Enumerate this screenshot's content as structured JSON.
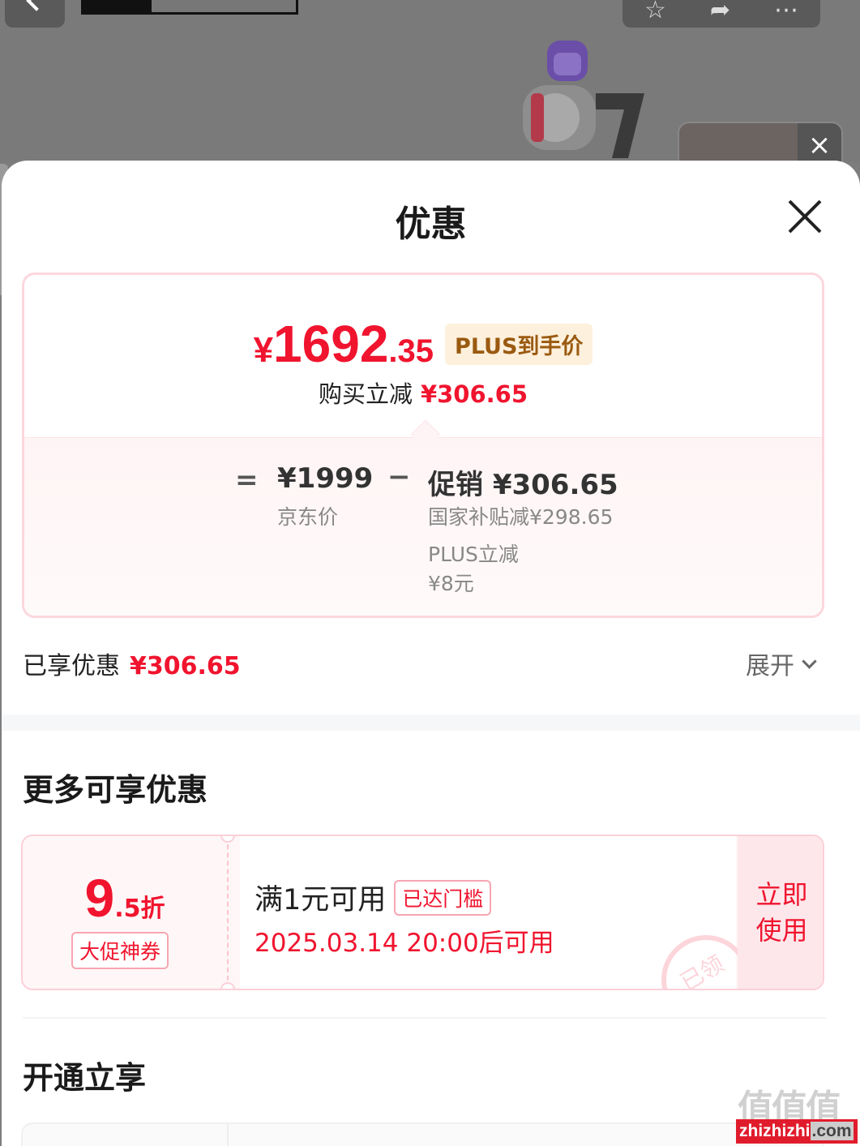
{
  "sheet": {
    "title": "优惠"
  },
  "summary": {
    "price_symbol": "¥",
    "price_int": "1692",
    "price_dec": ".35",
    "plus_tag": "PLUS到手价",
    "reduce_label": "购买立减",
    "reduce_amount": "¥306.65",
    "equals": "=",
    "minus": "−",
    "jd_price": "¥1999",
    "jd_price_label": "京东价",
    "promo_total": "促销 ¥306.65",
    "subsidy_line": "国家补贴减¥298.65",
    "plus_line": "PLUS立减",
    "plus_amount": "¥8元"
  },
  "enjoyed": {
    "label": "已享优惠",
    "amount": "¥306.65",
    "expand_label": "展开"
  },
  "more_section": {
    "title": "更多可享优惠"
  },
  "coupon": {
    "discount_num": "9",
    "discount_frac": ".5折",
    "tag": "大促神券",
    "condition": "满1元可用",
    "reached_badge": "已达门槛",
    "time": "2025.03.14 20:00后可用",
    "stamp": "已领",
    "use_label": "立即使用"
  },
  "open_section": {
    "title": "开通立享"
  },
  "watermark": {
    "glyphs": "值值值",
    "site": "zhizhizhi",
    "tld": ".com"
  },
  "colors": {
    "accent_red": "#f0142e",
    "plus_gold": "#9a5a10",
    "card_border": "#fcd7de"
  }
}
